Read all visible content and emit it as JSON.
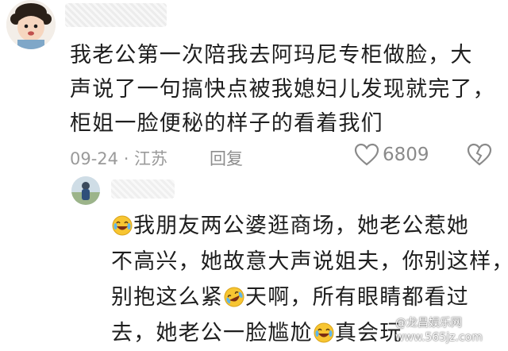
{
  "comment": {
    "lines": [
      "我老公第一次陪我去阿玛尼专柜做脸，大",
      "声说了一句搞快点被我媳妇儿发现就完了，",
      "柜姐一脸便秘的样子的看着我们"
    ],
    "date": "09-24 · 江苏",
    "reply_label": "回复",
    "like_count": "6809"
  },
  "reply": {
    "line1": "我朋友两公婆逛商场，她老公惹她",
    "line2": "不高兴，她故意大声说姐夫，你别这样，",
    "line3_before": "别抱这么紧",
    "line3_after": "天啊，所有眼睛都看过",
    "line4_before": "去，她老公一脸尴尬",
    "line4_after": "真会玩"
  },
  "watermark": {
    "line1": "@龙昌娱乐网",
    "line2": "www.565jz.com"
  },
  "colors": {
    "text": "#1e1e1e",
    "meta": "#9a9a9a",
    "emoji": "#f7c531"
  }
}
